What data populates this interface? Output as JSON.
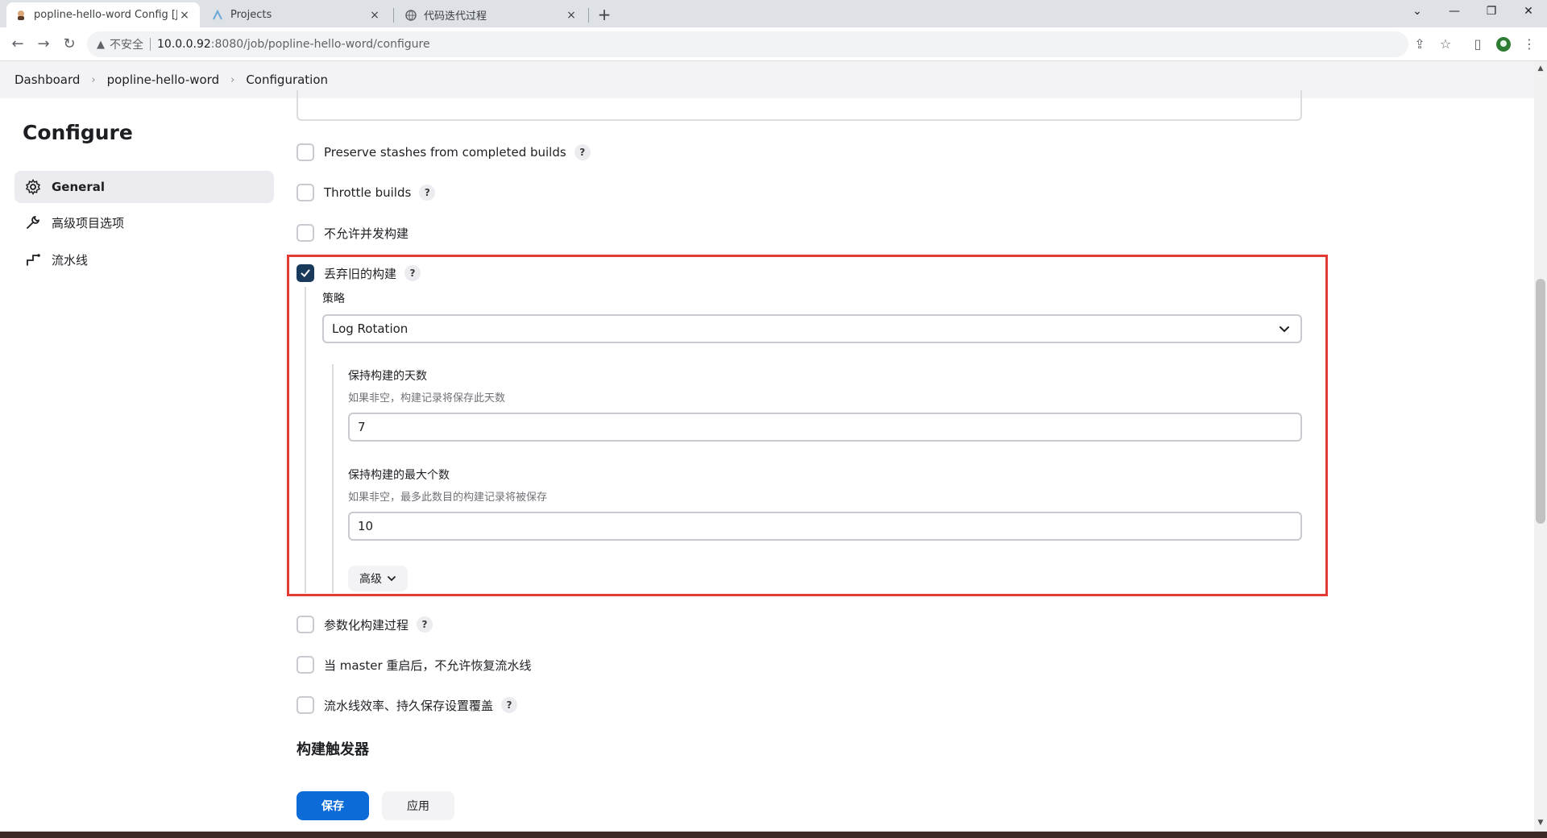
{
  "browser": {
    "tabs": [
      {
        "title": "popline-hello-word Config [Je",
        "icon": "jenkins-icon",
        "close": "×"
      },
      {
        "title": "Projects",
        "icon": "projects-icon",
        "close": "×"
      },
      {
        "title": "代码迭代过程",
        "icon": "globe-icon",
        "close": "×"
      }
    ],
    "new_tab": "+",
    "address": {
      "warning": "不安全",
      "host": "10.0.0.92",
      "path": ":8080/job/popline-hello-word/configure"
    }
  },
  "breadcrumb": [
    "Dashboard",
    "popline-hello-word",
    "Configuration"
  ],
  "sidebar": {
    "title": "Configure",
    "items": [
      {
        "label": "General",
        "icon": "gear-icon"
      },
      {
        "label": "高级项目选项",
        "icon": "wrench-icon"
      },
      {
        "label": "流水线",
        "icon": "pipeline-icon"
      }
    ]
  },
  "options": {
    "preserve_stashes": "Preserve stashes from completed builds",
    "throttle": "Throttle builds",
    "no_concurrent": "不允许并发构建",
    "discard_old": "丢弃旧的构建",
    "parameterized": "参数化构建过程",
    "no_resume": "当 master 重启后，不允许恢复流水线",
    "durability": "流水线效率、持久保存设置覆盖"
  },
  "discard": {
    "checked": true,
    "strategy_label": "策略",
    "strategy_value": "Log Rotation",
    "days_label": "保持构建的天数",
    "days_desc": "如果非空，构建记录将保存此天数",
    "days_value": "7",
    "max_label": "保持构建的最大个数",
    "max_desc": "如果非空，最多此数目的构建记录将被保存",
    "max_value": "10",
    "advanced": "高级"
  },
  "help_mark": "?",
  "section_triggers": "构建触发器",
  "buttons": {
    "save": "保存",
    "apply": "应用"
  }
}
